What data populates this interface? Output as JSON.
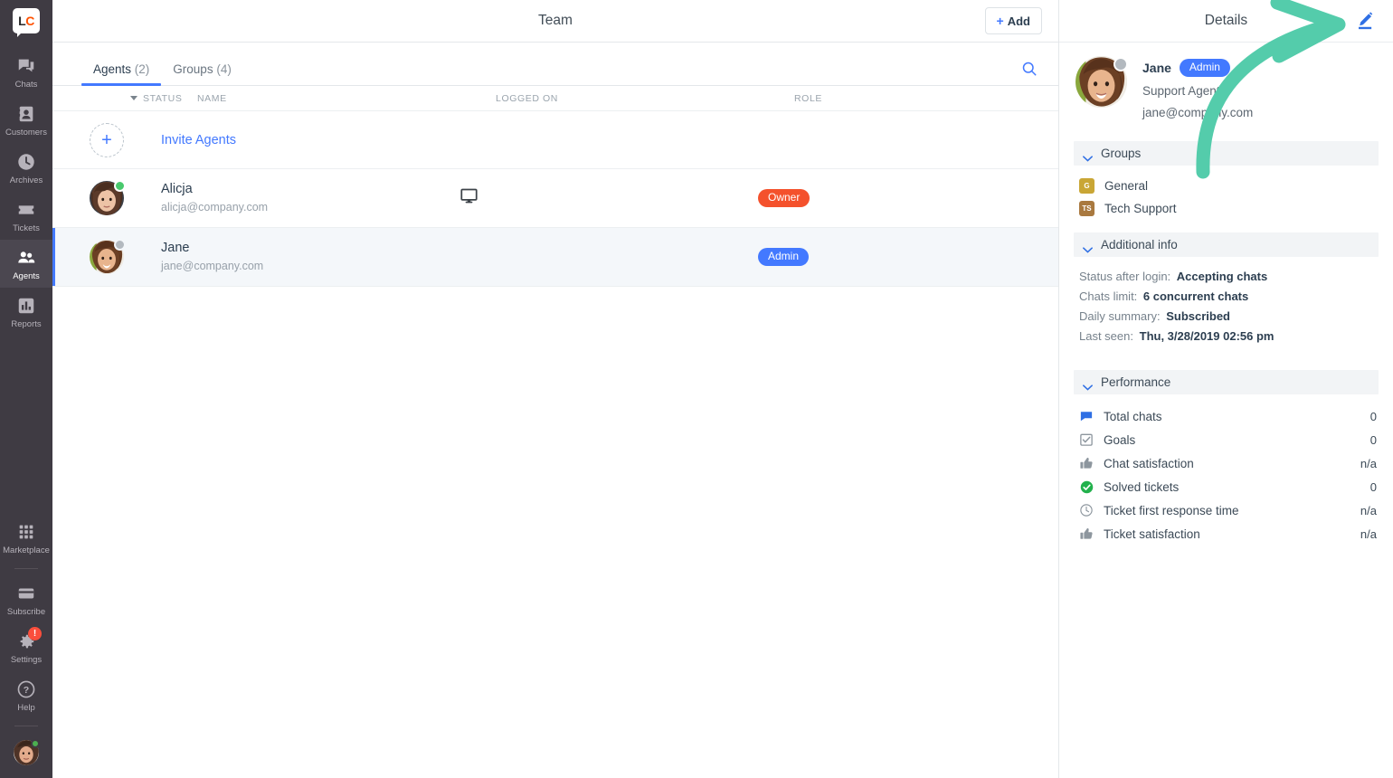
{
  "sidebar": {
    "logo": {
      "part1": "L",
      "part2": "C",
      "name": "livechat-logo"
    },
    "items": [
      {
        "label": "Chats",
        "icon": "chats-icon"
      },
      {
        "label": "Customers",
        "icon": "customers-icon"
      },
      {
        "label": "Archives",
        "icon": "archives-icon"
      },
      {
        "label": "Tickets",
        "icon": "tickets-icon"
      },
      {
        "label": "Agents",
        "icon": "agents-icon",
        "active": true
      },
      {
        "label": "Reports",
        "icon": "reports-icon"
      }
    ],
    "bottom_items": [
      {
        "label": "Marketplace",
        "icon": "marketplace-icon"
      },
      {
        "label": "Subscribe",
        "icon": "subscribe-icon"
      },
      {
        "label": "Settings",
        "icon": "gear-icon",
        "badge": "!"
      },
      {
        "label": "Help",
        "icon": "help-icon"
      }
    ]
  },
  "header": {
    "title": "Team",
    "add_label": "Add",
    "add_plus": "+"
  },
  "tabs": [
    {
      "label": "Agents",
      "count": "(2)",
      "active": true
    },
    {
      "label": "Groups",
      "count": "(4)",
      "active": false
    }
  ],
  "table": {
    "columns": {
      "status": "STATUS",
      "name": "NAME",
      "logged_on": "LOGGED ON",
      "role": "ROLE"
    },
    "invite_row": {
      "label": "Invite Agents",
      "plus": "+"
    },
    "rows": [
      {
        "name": "Alicja",
        "email": "alicja@company.com",
        "status": "online",
        "logged_on": "desktop",
        "role": "Owner",
        "role_color": "#f4512c",
        "selected": false
      },
      {
        "name": "Jane",
        "email": "jane@company.com",
        "status": "offline",
        "logged_on": "",
        "role": "Admin",
        "role_color": "#4379ff",
        "selected": true
      }
    ]
  },
  "details": {
    "title": "Details",
    "edit_icon": "edit-pencil-icon",
    "profile": {
      "name": "Jane",
      "badge": "Admin",
      "role": "Support Agent",
      "email": "jane@company.com",
      "status": "offline"
    },
    "groups_section": {
      "title": "Groups",
      "items": [
        {
          "initials": "G",
          "name": "General",
          "color": "#c9a635"
        },
        {
          "initials": "TS",
          "name": "Tech Support",
          "color": "#a9793f"
        }
      ]
    },
    "additional_section": {
      "title": "Additional info",
      "items": [
        {
          "label": "Status after login:",
          "value": "Accepting chats"
        },
        {
          "label": "Chats limit:",
          "value": "6 concurrent chats"
        },
        {
          "label": "Daily summary:",
          "value": "Subscribed"
        },
        {
          "label": "Last seen:",
          "value": "Thu, 3/28/2019 02:56 pm"
        }
      ]
    },
    "performance_section": {
      "title": "Performance",
      "items": [
        {
          "label": "Total chats",
          "value": "0",
          "icon": "chat-bubble-icon"
        },
        {
          "label": "Goals",
          "value": "0",
          "icon": "checkbox-icon"
        },
        {
          "label": "Chat satisfaction",
          "value": "n/a",
          "icon": "thumbs-up-icon"
        },
        {
          "label": "Solved tickets",
          "value": "0",
          "icon": "check-circle-icon"
        },
        {
          "label": "Ticket first response time",
          "value": "n/a",
          "icon": "clock-icon"
        },
        {
          "label": "Ticket satisfaction",
          "value": "n/a",
          "icon": "thumbs-up-icon"
        }
      ]
    }
  },
  "annotation": {
    "type": "curved-arrow",
    "color": "#54ccab",
    "points_to": "edit-pencil-icon"
  }
}
